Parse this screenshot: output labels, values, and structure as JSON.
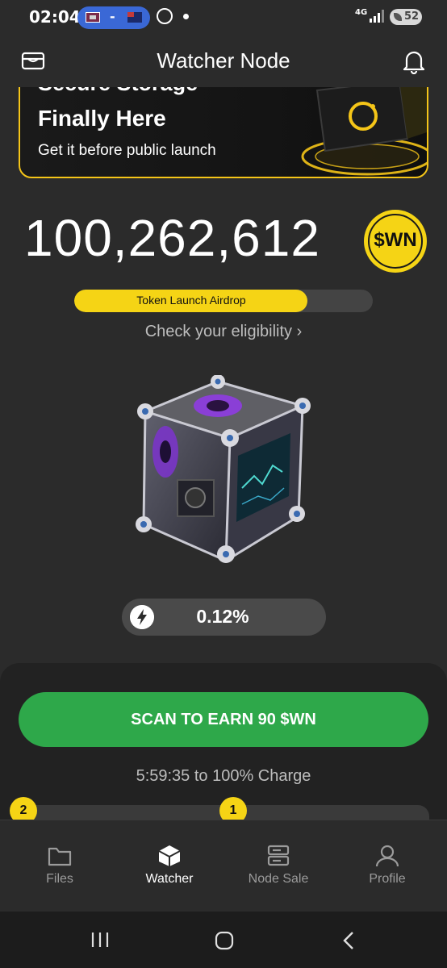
{
  "status_bar": {
    "time": "02:04",
    "network": "4G",
    "battery": "52",
    "pill_separator": "-",
    "icons": [
      "flag-icon",
      "flag-icon",
      "whatsapp-icon",
      "notification-dot-icon",
      "signal-icon",
      "battery-icon"
    ]
  },
  "header": {
    "title": "Watcher Node",
    "left_icon": "wallet-icon",
    "right_icon": "bell-icon"
  },
  "banner": {
    "line1": "Secure Storage",
    "line2": "Finally Here",
    "subtitle": "Get it before public launch",
    "accent_color": "#f5c518"
  },
  "balance": {
    "amount": "100,262,612",
    "token_symbol": "$WN"
  },
  "airdrop": {
    "label": "Token Launch Airdrop",
    "progress": 0.78,
    "eligibility_link": "Check your eligibility"
  },
  "charge": {
    "icon": "lightning-icon",
    "value": "0.12%"
  },
  "action": {
    "scan_button": "SCAN TO EARN 90 $WN",
    "timer": "5:59:35 to 100% Charge",
    "badges": [
      "2",
      "1"
    ],
    "button_color": "#2ea84a"
  },
  "nav": {
    "items": [
      {
        "label": "Files",
        "icon": "folder-icon",
        "active": false
      },
      {
        "label": "Watcher",
        "icon": "cube-icon",
        "active": true
      },
      {
        "label": "Node Sale",
        "icon": "server-icon",
        "active": false
      },
      {
        "label": "Profile",
        "icon": "user-icon",
        "active": false
      }
    ]
  },
  "system_nav": {
    "icons": [
      "recents-icon",
      "home-icon",
      "back-icon"
    ]
  }
}
